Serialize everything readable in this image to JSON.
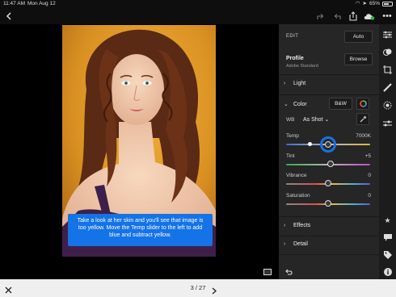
{
  "status": {
    "time": "11:47 AM",
    "date": "Mon Aug 12",
    "battery": "65%"
  },
  "icons": {
    "back": "chevron-left-icon",
    "undo": "undo-icon",
    "redo": "redo-icon",
    "share": "share-icon",
    "cloud": "cloud-sync-icon",
    "more": "more-icon"
  },
  "edit_panel": {
    "title": "EDIT",
    "auto_label": "Auto",
    "profile_label": "Profile",
    "profile_value": "Adobe Standard",
    "browse_label": "Browse",
    "sections": {
      "light": "Light",
      "color": "Color",
      "effects": "Effects",
      "detail": "Detail"
    },
    "bw_label": "B&W",
    "wb_label": "WB",
    "wb_value": "As Shot",
    "sliders": [
      {
        "label": "Temp",
        "value": "7000K",
        "position": 0.5
      },
      {
        "label": "Tint",
        "value": "+5",
        "position": 0.53
      },
      {
        "label": "Vibrance",
        "value": "0",
        "position": 0.5
      },
      {
        "label": "Saturation",
        "value": "0",
        "position": 0.5
      }
    ],
    "temp_marker": 0.28
  },
  "tooltip": "Take a look at her skin and you'll see that image is too yellow. Move the Temp slider to the left to add blue and subtract yellow.",
  "pager": {
    "current": "3",
    "total": "27",
    "text": "3 / 27"
  },
  "colors": {
    "accent": "#1473e6",
    "panel": "#262626",
    "background": "#000000"
  }
}
